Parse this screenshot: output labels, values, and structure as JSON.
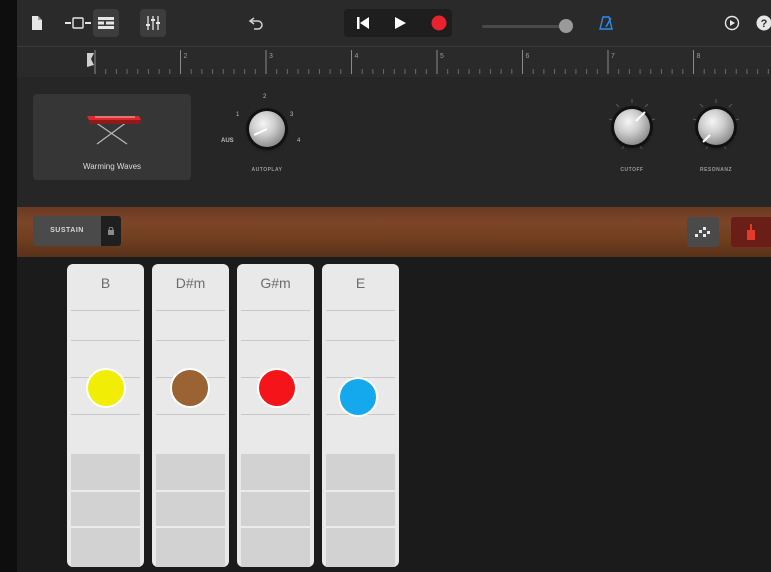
{
  "toolbar": {
    "icons": [
      "document-icon",
      "tracks-view-icon",
      "list-view-icon",
      "mixer-icon",
      "undo-icon",
      "rewind-icon",
      "play-icon",
      "record-icon",
      "metronome-icon",
      "settings-icon",
      "help-icon"
    ],
    "volume": 0.93,
    "colors": {
      "record": "#e8232d",
      "metronome": "#2f8ce8"
    }
  },
  "ruler": {
    "bars": [
      "2",
      "3",
      "4",
      "5",
      "6",
      "7",
      "8"
    ]
  },
  "instrument": {
    "name": "Warming Waves"
  },
  "knobs": {
    "autoplay": {
      "label": "AUTOPLAY",
      "positions": [
        "AUS",
        "1",
        "2",
        "3",
        "4"
      ]
    },
    "cutoff": {
      "label": "CUTOFF"
    },
    "resonance": {
      "label": "RESONANZ"
    }
  },
  "controls": {
    "sustain_label": "SUSTAIN"
  },
  "chords": [
    {
      "name": "B",
      "color": "#f2ed05"
    },
    {
      "name": "D#m",
      "color": "#9b6233"
    },
    {
      "name": "G#m",
      "color": "#f5141a"
    },
    {
      "name": "E",
      "color": "#14a8ec"
    }
  ]
}
